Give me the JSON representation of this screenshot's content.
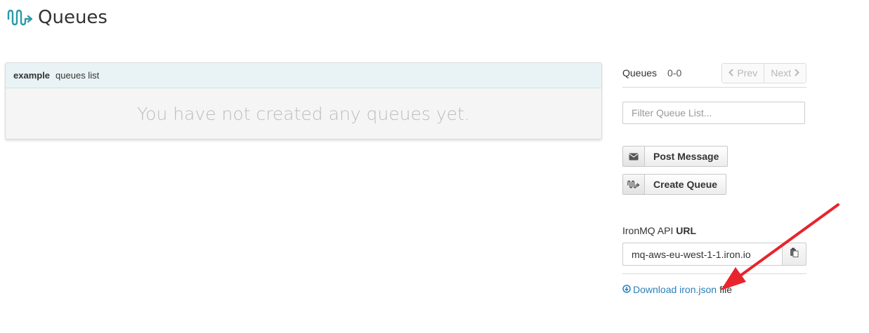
{
  "header": {
    "icon": "ironmq-wave-icon",
    "title": "Queues"
  },
  "panel": {
    "project": "example",
    "subtitle": "queues list",
    "empty_message": "You have not created any queues yet."
  },
  "sidebar": {
    "queues_label": "Queues",
    "queues_range": "0-0",
    "prev_label": "Prev",
    "next_label": "Next",
    "filter_placeholder": "Filter Queue List...",
    "post_message_label": "Post Message",
    "create_queue_label": "Create Queue",
    "api_label_prefix": "IronMQ API",
    "api_label_bold": "URL",
    "api_url": "mq-aws-eu-west-1-1.iron.io",
    "download_link": "Download iron.json",
    "download_suffix": "file"
  },
  "colors": {
    "brand": "#2a9aa8",
    "link": "#2a80b9",
    "annotation_arrow": "#e8242c"
  }
}
